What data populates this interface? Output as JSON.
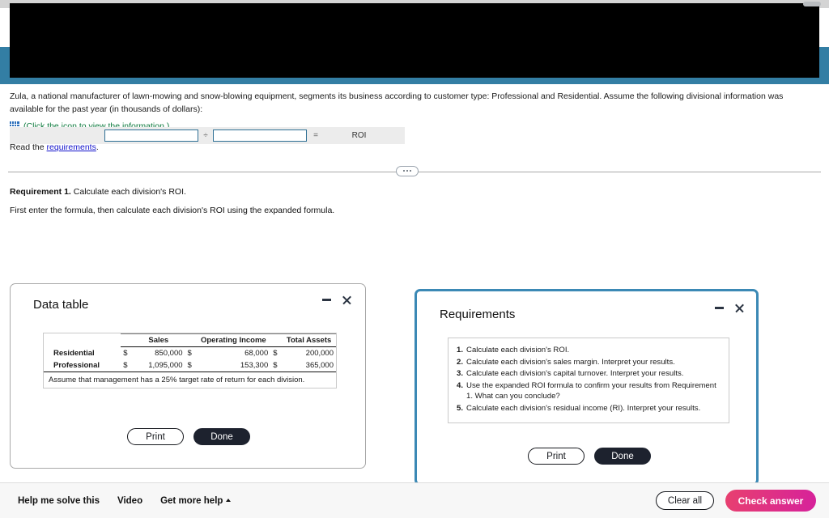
{
  "problem": {
    "statement": "Zula, a national manufacturer of lawn-mowing and snow-blowing equipment, segments its business according to customer type: Professional and Residential. Assume the following divisional information was available for the past year (in thousands of dollars):",
    "icon_name": "table-grid-icon",
    "icon_caption": "(Click the icon to view the information.)",
    "read_prefix": "Read the ",
    "read_link": "requirements",
    "read_suffix": "."
  },
  "requirement_section": {
    "heading_bold": "Requirement 1.",
    "heading_rest": " Calculate each division's ROI.",
    "instruction": "First enter the formula, then calculate each division's ROI using the expanded formula.",
    "formula": {
      "input1_value": "",
      "input1_placeholder": "",
      "operator": "÷",
      "input2_value": "",
      "input2_placeholder": "",
      "equals": "=",
      "result_label": "ROI"
    }
  },
  "data_table_dialog": {
    "title": "Data table",
    "minimize_label": "minimize",
    "close_label": "close",
    "columns": [
      "",
      "Sales",
      "Operating Income",
      "Total Assets"
    ],
    "rows": [
      {
        "label": "Residential",
        "sales_cur": "$",
        "sales": "850,000",
        "oi_cur": "$",
        "operating_income": "68,000",
        "ta_cur": "$",
        "total_assets": "200,000"
      },
      {
        "label": "Professional",
        "sales_cur": "$",
        "sales": "1,095,000",
        "oi_cur": "$",
        "operating_income": "153,300",
        "ta_cur": "$",
        "total_assets": "365,000"
      }
    ],
    "note": "Assume that management has a 25% target rate of return for each division.",
    "print_label": "Print",
    "done_label": "Done"
  },
  "requirements_dialog": {
    "title": "Requirements",
    "minimize_label": "minimize",
    "close_label": "close",
    "items": [
      {
        "num": "1.",
        "text": "Calculate each division's ROI."
      },
      {
        "num": "2.",
        "text": "Calculate each division's sales margin. Interpret your results."
      },
      {
        "num": "3.",
        "text": "Calculate each division's capital turnover. Interpret your results."
      },
      {
        "num": "4.",
        "text": "Use the expanded ROI formula to confirm your results from Requirement 1. What can you conclude?"
      },
      {
        "num": "5.",
        "text": "Calculate each division's residual income (RI). Interpret your results."
      }
    ],
    "print_label": "Print",
    "done_label": "Done"
  },
  "bottom_bar": {
    "help_me_solve": "Help me solve this",
    "video": "Video",
    "get_more_help": "Get more help",
    "clear_all": "Clear all",
    "check_answer": "Check answer"
  },
  "colors": {
    "accent_teal": "#337ea4",
    "link_blue": "#1414cc",
    "icon_green": "#0f7b3f",
    "check_answer_start": "#e8406f",
    "check_answer_end": "#d6219b",
    "dialog_dark": "#1d222e",
    "active_border": "#3b89b5"
  }
}
